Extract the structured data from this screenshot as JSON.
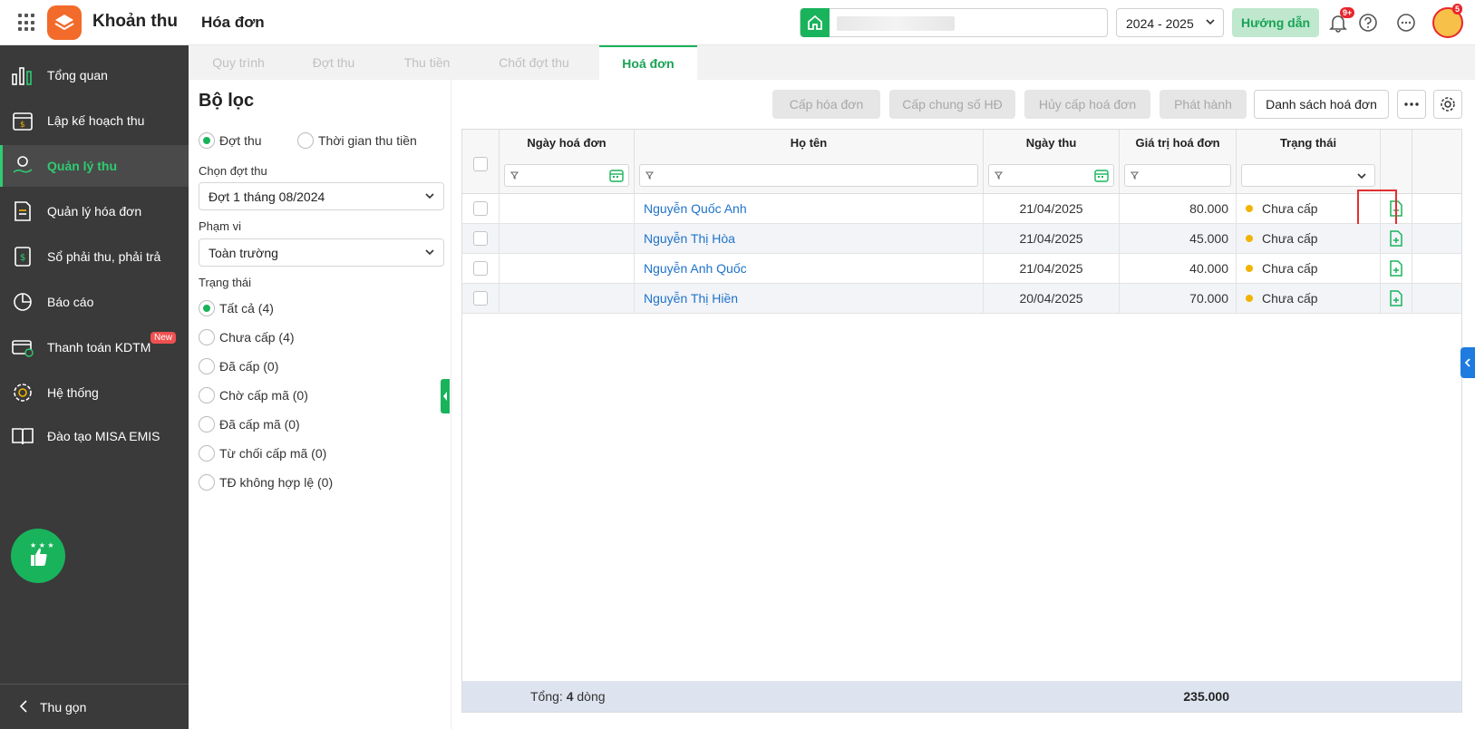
{
  "header": {
    "app_name": "Khoản thu",
    "page_title": "Hóa đơn",
    "year": "2024 - 2025",
    "guide_label": "Hướng dẫn",
    "notification_badge": "9+",
    "avatar_badge": "5"
  },
  "sidebar": {
    "items": [
      {
        "label": "Tổng quan",
        "icon": "chart-bars-icon"
      },
      {
        "label": "Lập kế hoạch thu",
        "icon": "calendar-money-icon"
      },
      {
        "label": "Quản lý thu",
        "icon": "hand-coin-icon"
      },
      {
        "label": "Quản lý hóa đơn",
        "icon": "invoice-icon"
      },
      {
        "label": "Sổ phải thu, phải trả",
        "icon": "ledger-icon"
      },
      {
        "label": "Báo cáo",
        "icon": "pie-chart-icon"
      },
      {
        "label": "Thanh toán KDTM",
        "icon": "card-payment-icon"
      },
      {
        "label": "Hệ thống",
        "icon": "gear-icon"
      },
      {
        "label": "Đào tạo MISA EMIS",
        "icon": "book-icon"
      }
    ],
    "new_badge": "New",
    "collapse_label": "Thu gọn"
  },
  "tabs": [
    "Quy trình",
    "Đợt thu",
    "Thu tiền",
    "Chốt đợt thu",
    "Hoá đơn"
  ],
  "filter": {
    "title": "Bộ lọc",
    "mode_options": [
      "Đợt thu",
      "Thời gian thu tiền"
    ],
    "period_label": "Chọn đợt thu",
    "period_value": "Đợt 1 tháng 08/2024",
    "scope_label": "Phạm vi",
    "scope_value": "Toàn trường",
    "status_label": "Trạng thái",
    "status_options": [
      "Tất cả (4)",
      "Chưa cấp (4)",
      "Đã cấp (0)",
      "Chờ cấp mã (0)",
      "Đã cấp mã (0)",
      "Từ chối cấp mã (0)",
      "TĐ không hợp lệ (0)"
    ]
  },
  "toolbar": {
    "issue": "Cấp hóa đơn",
    "issue_common": "Cấp chung số HĐ",
    "cancel_issue": "Hủy cấp hoá đơn",
    "publish": "Phát hành",
    "invoice_list": "Danh sách hoá đơn"
  },
  "table": {
    "columns": [
      "Ngày hoá đơn",
      "Họ tên",
      "Ngày thu",
      "Giá trị hoá đơn",
      "Trạng thái"
    ],
    "rows": [
      {
        "name": "Nguyễn Quốc Anh",
        "date": "21/04/2025",
        "value": "80.000",
        "status": "Chưa cấp"
      },
      {
        "name": "Nguyễn Thị Hòa",
        "date": "21/04/2025",
        "value": "45.000",
        "status": "Chưa cấp"
      },
      {
        "name": "Nguyễn Anh Quốc",
        "date": "21/04/2025",
        "value": "40.000",
        "status": "Chưa cấp"
      },
      {
        "name": "Nguyễn Thị Hiền",
        "date": "20/04/2025",
        "value": "70.000",
        "status": "Chưa cấp"
      }
    ],
    "footer_prefix": "Tổng: ",
    "footer_count": "4",
    "footer_suffix": " dòng",
    "footer_total": "235.000"
  },
  "colors": {
    "accent": "#19b35c",
    "sidebar_bg": "#3a3a3a",
    "link": "#1f73c8",
    "status_pending": "#f0b400",
    "highlight": "#e23030"
  }
}
